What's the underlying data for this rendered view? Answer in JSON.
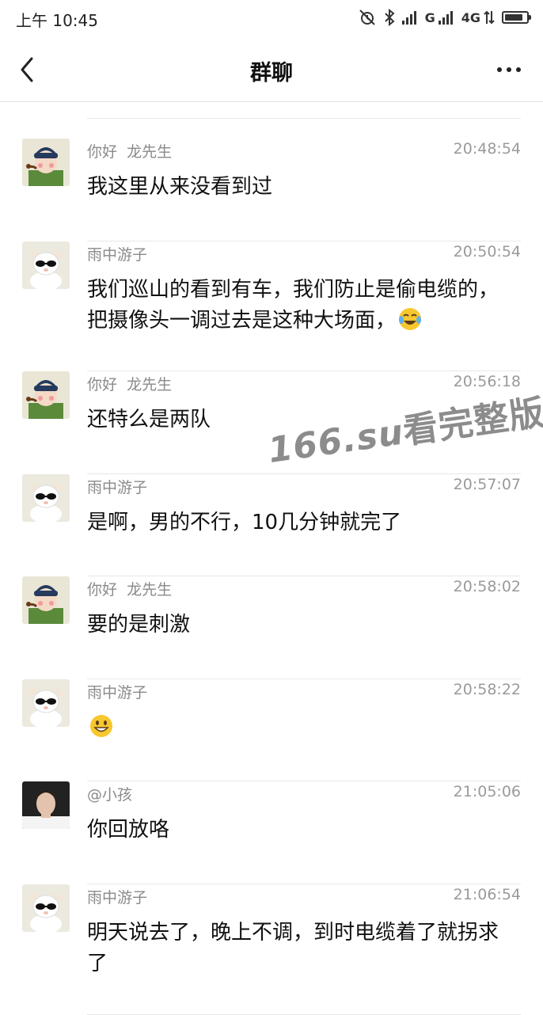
{
  "status_bar": {
    "time": "上午 10:45",
    "carrier1": "G",
    "carrier2": "4G",
    "battery_level": 0.85
  },
  "nav": {
    "title": "群聊"
  },
  "messages": [
    {
      "sender": "你好  龙先生",
      "time": "20:48:54",
      "text": "我这里从来没看到过",
      "avatar": "avatar-pipe-boy"
    },
    {
      "sender": "雨中游子",
      "time": "20:50:54",
      "text": "我们巡山的看到有车，我们防止是偷电缆的，把摄像头一调过去是这种大场面，",
      "emoji": "tears-of-joy-emoji",
      "avatar": "avatar-sunglasses-sheep"
    },
    {
      "sender": "你好  龙先生",
      "time": "20:56:18",
      "text": "还特么是两队",
      "avatar": "avatar-pipe-boy"
    },
    {
      "sender": "雨中游子",
      "time": "20:57:07",
      "text": "是啊，男的不行，10几分钟就完了",
      "avatar": "avatar-sunglasses-sheep"
    },
    {
      "sender": "你好  龙先生",
      "time": "20:58:02",
      "text": "要的是刺激",
      "avatar": "avatar-pipe-boy"
    },
    {
      "sender": "雨中游子",
      "time": "20:58:22",
      "text": "",
      "emoji": "grinning-emoji",
      "avatar": "avatar-sunglasses-sheep"
    },
    {
      "sender": "@小孩",
      "time": "21:05:06",
      "text": "你回放咯",
      "avatar": "avatar-boy-photo"
    },
    {
      "sender": "雨中游子",
      "time": "21:06:54",
      "text": "明天说去了，晚上不调，到时电缆着了就拐求了",
      "avatar": "avatar-sunglasses-sheep"
    }
  ],
  "watermark": {
    "domain": "166.su",
    "text": "看完整版"
  }
}
